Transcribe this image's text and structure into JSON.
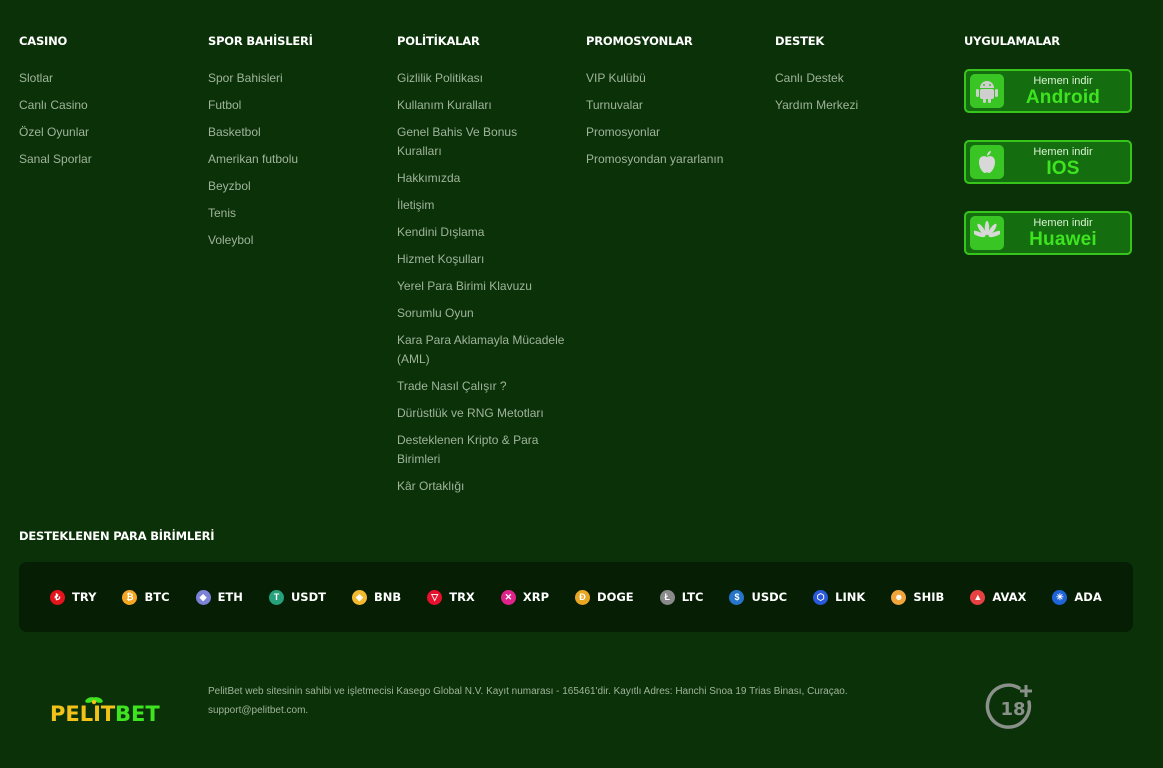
{
  "columns": [
    {
      "title": "CASINO",
      "items": [
        "Slotlar",
        "Canlı Casino",
        "Özel Oyunlar",
        "Sanal Sporlar"
      ]
    },
    {
      "title": "SPOR BAHİSLERİ",
      "items": [
        "Spor Bahisleri",
        "Futbol",
        "Basketbol",
        "Amerikan futbolu",
        "Beyzbol",
        "Tenis",
        "Voleybol"
      ]
    },
    {
      "title": "POLİTİKALAR",
      "items": [
        "Gizlilik Politikası",
        "Kullanım Kuralları",
        "Genel Bahis Ve Bonus Kuralları",
        "Hakkımızda",
        "İletişim",
        "Kendini Dışlama",
        "Hizmet Koşulları",
        "Yerel Para Birimi Klavuzu",
        "Sorumlu Oyun",
        "Kara Para Aklamayla Mücadele (AML)",
        "Trade Nasıl Çalışır ?",
        "Dürüstlük ve RNG Metotları",
        "Desteklenen Kripto & Para Birimleri",
        "Kâr Ortaklığı"
      ]
    },
    {
      "title": "PROMOSYONLAR",
      "items": [
        "VIP Kulübü",
        "Turnuvalar",
        "Promosyonlar",
        "Promosyondan yararlanın"
      ]
    },
    {
      "title": "DESTEK",
      "items": [
        "Canlı Destek",
        "Yardım Merkezi"
      ]
    }
  ],
  "apps": {
    "title": "UYGULAMALAR",
    "download_label": "Hemen indir",
    "items": [
      {
        "platform": "Android",
        "icon": "android-icon"
      },
      {
        "platform": "IOS",
        "icon": "apple-icon"
      },
      {
        "platform": "Huawei",
        "icon": "huawei-icon"
      }
    ]
  },
  "currencies": {
    "title": "DESTEKLENEN PARA BİRİMLERİ",
    "items": [
      {
        "code": "TRY",
        "color": "#e3141c",
        "glyph": "₺"
      },
      {
        "code": "BTC",
        "color": "#f5a623",
        "glyph": "₿"
      },
      {
        "code": "ETH",
        "color": "#7b83d6",
        "glyph": "◆"
      },
      {
        "code": "USDT",
        "color": "#26a17b",
        "glyph": "T"
      },
      {
        "code": "BNB",
        "color": "#f3ba2f",
        "glyph": "◈"
      },
      {
        "code": "TRX",
        "color": "#e5112d",
        "glyph": "▽"
      },
      {
        "code": "XRP",
        "color": "#e0238a",
        "glyph": "✕"
      },
      {
        "code": "DOGE",
        "color": "#e8a623",
        "glyph": "Ð"
      },
      {
        "code": "LTC",
        "color": "#8a8a8a",
        "glyph": "Ł"
      },
      {
        "code": "USDC",
        "color": "#2775ca",
        "glyph": "$"
      },
      {
        "code": "LINK",
        "color": "#2a5ada",
        "glyph": "⬡"
      },
      {
        "code": "SHIB",
        "color": "#f2a53a",
        "glyph": "☻"
      },
      {
        "code": "AVAX",
        "color": "#e84142",
        "glyph": "▲"
      },
      {
        "code": "ADA",
        "color": "#1f64d8",
        "glyph": "✳"
      }
    ]
  },
  "footer": {
    "logo_part1": "PELIT",
    "logo_part2": "BET",
    "legal_line1": "PelitBet web sitesinin sahibi ve işletmecisi Kasego Global N.V. Kayıt numarası - 165461'dir. Kayıtlı Adres: Hanchi Snoa 19 Trias Binası, Curaçao.",
    "legal_line2": "support@pelitbet.com.",
    "age_label": "18"
  },
  "colors": {
    "background": "#0b3108",
    "currency_bar": "#051e04",
    "accent_green": "#3ee420",
    "logo_yellow": "#f2c21a"
  }
}
